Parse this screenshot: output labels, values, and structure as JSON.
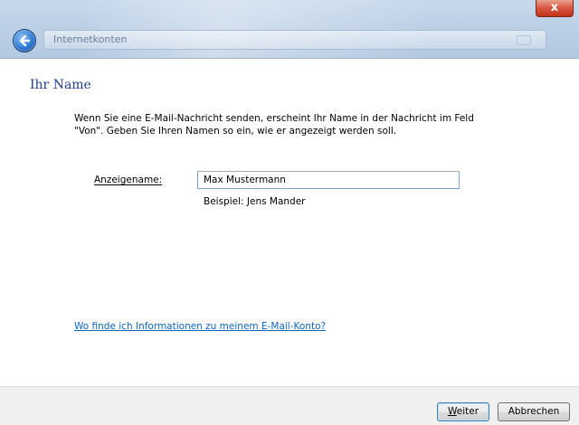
{
  "window": {
    "title": "Internetkonten",
    "close_glyph": "x",
    "back_icon": "back-arrow-icon"
  },
  "page": {
    "heading": "Ihr Name",
    "description_line1": "Wenn Sie eine E-Mail-Nachricht senden, erscheint Ihr Name in der Nachricht im Feld",
    "description_line2": "\"Von\". Geben Sie Ihren Namen so ein, wie er angezeigt werden soll.",
    "display_name_label": "Anzeigename:",
    "display_name_value": "Max Mustermann",
    "example": "Beispiel: Jens Mander",
    "help_link": "Wo finde ich Informationen zu meinem E-Mail-Konto?"
  },
  "footer": {
    "next_label_accel": "W",
    "next_label_rest": "eiter",
    "cancel_label": "Abbrechen"
  },
  "colors": {
    "heading": "#1f3f8a",
    "link": "#0b66c0",
    "close_button": "#d7553e"
  }
}
